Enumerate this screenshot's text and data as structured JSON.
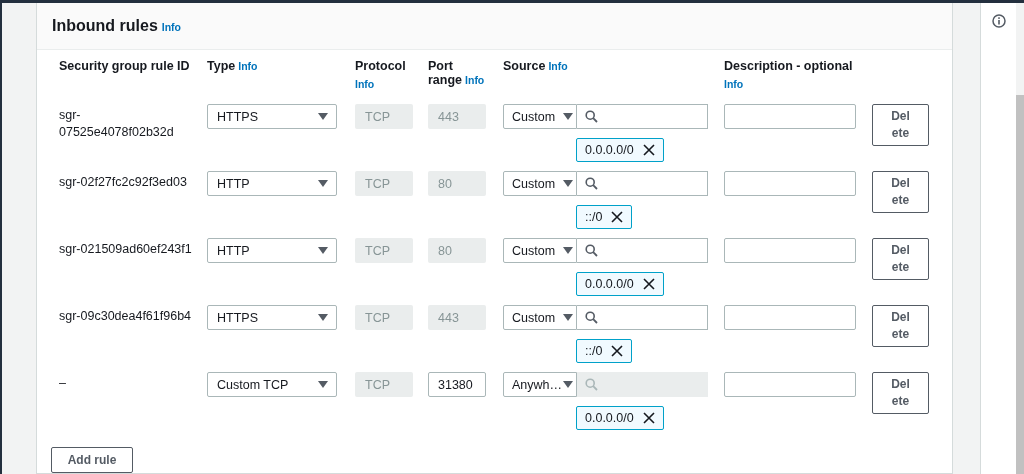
{
  "panel": {
    "title": "Inbound rules",
    "info": "Info"
  },
  "columns": [
    {
      "label": "Security group rule ID"
    },
    {
      "label": "Type",
      "info": "Info"
    },
    {
      "label": "Protocol",
      "info": "Info",
      "info_below": true
    },
    {
      "label": "Port range",
      "info": "Info"
    },
    {
      "label": "Source",
      "info": "Info"
    },
    {
      "label": "Description - optional",
      "info": "Info",
      "info_below": true
    }
  ],
  "rules": [
    {
      "id": "sgr-07525e4078f02b32d",
      "type": "HTTPS",
      "protocol": "TCP",
      "port": "443",
      "port_disabled": true,
      "source": "Custom",
      "search_disabled": false,
      "token": "0.0.0.0/0",
      "delete": "Delete"
    },
    {
      "id": "sgr-02f27fc2c92f3ed03",
      "type": "HTTP",
      "protocol": "TCP",
      "port": "80",
      "port_disabled": true,
      "source": "Custom",
      "search_disabled": false,
      "token": "::/0",
      "delete": "Delete"
    },
    {
      "id": "sgr-021509ad60ef243f1",
      "type": "HTTP",
      "protocol": "TCP",
      "port": "80",
      "port_disabled": true,
      "source": "Custom",
      "search_disabled": false,
      "token": "0.0.0.0/0",
      "delete": "Delete"
    },
    {
      "id": "sgr-09c30dea4f61f96b4",
      "type": "HTTPS",
      "protocol": "TCP",
      "port": "443",
      "port_disabled": true,
      "source": "Custom",
      "search_disabled": false,
      "token": "::/0",
      "delete": "Delete"
    },
    {
      "id": "–",
      "type": "Custom TCP",
      "protocol": "TCP",
      "port": "31380",
      "port_disabled": false,
      "source": "Anywh…",
      "search_disabled": true,
      "token": "0.0.0.0/0",
      "delete": "Delete"
    }
  ],
  "add_button": "Add rule"
}
